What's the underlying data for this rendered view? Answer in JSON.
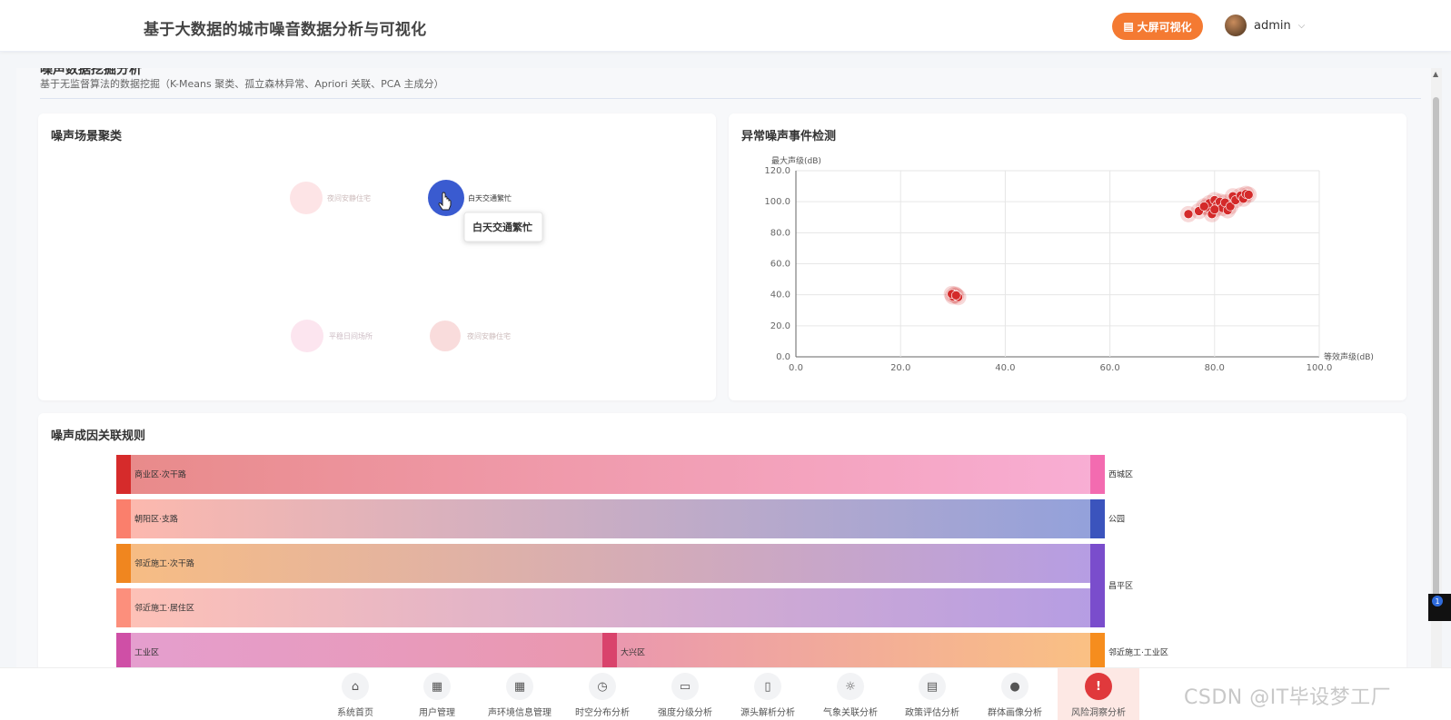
{
  "header": {
    "title": "基于大数据的城市噪音数据分析与可视化",
    "bigscreen_label": "大屏可视化",
    "username": "admin",
    "accent": "#f47a32"
  },
  "page": {
    "heading": "噪声数据挖掘分析",
    "subtitle": "基于无监督算法的数据挖掘（K-Means 聚类、孤立森林异常、Apriori 关联、PCA 主成分）"
  },
  "cards": {
    "cluster": {
      "title": "噪声场景聚类",
      "nodes": [
        {
          "label": "夜间安静住宅",
          "color": "#fde4e6",
          "faded": true
        },
        {
          "label": "白天交通繁忙",
          "color": "#3a5bd0",
          "faded": false
        },
        {
          "label": "平稳日间场所",
          "color": "#fce5ef",
          "faded": true
        },
        {
          "label": "夜间安静住宅",
          "color": "#f9dcdc",
          "faded": true
        }
      ],
      "tooltip": "白天交通繁忙"
    },
    "anomaly": {
      "title": "异常噪声事件检测"
    },
    "rules": {
      "title": "噪声成因关联规则"
    }
  },
  "chart_data": [
    {
      "type": "scatter",
      "title": "异常噪声事件检测",
      "xlabel": "等效声级(dB)",
      "ylabel": "最大声级(dB)",
      "xlim": [
        0,
        100
      ],
      "ylim": [
        0,
        120
      ],
      "xticks": [
        "0.0",
        "20.0",
        "40.0",
        "60.0",
        "80.0",
        "100.0"
      ],
      "yticks": [
        "0.0",
        "20.0",
        "40.0",
        "60.0",
        "80.0",
        "100.0",
        "120.0"
      ],
      "grid": true,
      "color": "#d42a2a",
      "points": [
        [
          30.0,
          39.0
        ],
        [
          30.4,
          40.2
        ],
        [
          31.0,
          38.5
        ],
        [
          29.8,
          40.5
        ],
        [
          30.6,
          39.6
        ],
        [
          75.0,
          92.0
        ],
        [
          77.0,
          94.0
        ],
        [
          78.5,
          96.5
        ],
        [
          79.0,
          99.0
        ],
        [
          79.5,
          92.0
        ],
        [
          80.0,
          101.0
        ],
        [
          80.5,
          98.0
        ],
        [
          81.0,
          100.0
        ],
        [
          81.5,
          96.0
        ],
        [
          82.0,
          99.5
        ],
        [
          82.5,
          94.5
        ],
        [
          83.0,
          97.0
        ],
        [
          83.5,
          103.5
        ],
        [
          84.0,
          101.0
        ],
        [
          85.0,
          104.0
        ],
        [
          85.5,
          102.0
        ],
        [
          86.0,
          105.0
        ],
        [
          86.5,
          104.5
        ],
        [
          78.0,
          97.0
        ],
        [
          80.0,
          95.0
        ]
      ]
    },
    {
      "type": "sankey",
      "title": "噪声成因关联规则",
      "nodes_left": [
        {
          "label": "商业区·次干路",
          "color": "#d62b2b"
        },
        {
          "label": "朝阳区·支路",
          "color": "#fa7f6c"
        },
        {
          "label": "邻近施工·次干路",
          "color": "#f0861f"
        },
        {
          "label": "邻近施工·居住区",
          "color": "#fc8f7c"
        },
        {
          "label": "工业区",
          "color": "#cf4fa6"
        }
      ],
      "nodes_right": [
        {
          "label": "西城区",
          "color": "#f36bb0"
        },
        {
          "label": "公园",
          "color": "#3b54bd"
        },
        {
          "label": "昌平区",
          "color": "#7a4dcc"
        },
        {
          "label": "邻近施工·工业区",
          "color": "#f68d1e"
        }
      ],
      "node_mid": {
        "label": "大兴区",
        "color": "#d9436c"
      },
      "links": [
        {
          "source": "商业区·次干路",
          "target": "西城区",
          "value": 1
        },
        {
          "source": "朝阳区·支路",
          "target": "公园",
          "value": 1
        },
        {
          "source": "邻近施工·次干路",
          "target": "昌平区",
          "value": 1
        },
        {
          "source": "邻近施工·居住区",
          "target": "昌平区",
          "value": 1
        },
        {
          "source": "工业区",
          "target": "大兴区",
          "value": 1
        },
        {
          "source": "大兴区",
          "target": "邻近施工·工业区",
          "value": 1
        }
      ]
    }
  ],
  "nav": [
    {
      "label": "系统首页",
      "icon": "home-icon",
      "glyph": "⌂",
      "active": false
    },
    {
      "label": "用户管理",
      "icon": "grid-icon",
      "glyph": "▦",
      "active": false
    },
    {
      "label": "声环境信息管理",
      "icon": "grid-icon",
      "glyph": "▦",
      "active": false
    },
    {
      "label": "时空分布分析",
      "icon": "clock-icon",
      "glyph": "◷",
      "active": false
    },
    {
      "label": "强度分级分析",
      "icon": "presentation-icon",
      "glyph": "▭",
      "active": false
    },
    {
      "label": "源头解析分析",
      "icon": "book-icon",
      "glyph": "▯",
      "active": false
    },
    {
      "label": "气象关联分析",
      "icon": "sun-icon",
      "glyph": "☼",
      "active": false
    },
    {
      "label": "政策评估分析",
      "icon": "document-icon",
      "glyph": "▤",
      "active": false
    },
    {
      "label": "群体画像分析",
      "icon": "user-icon",
      "glyph": "●",
      "active": false
    },
    {
      "label": "风险洞察分析",
      "icon": "alert-icon",
      "glyph": "!",
      "active": true
    }
  ],
  "float_badge": "1",
  "watermark": "CSDN @IT毕设梦工厂"
}
